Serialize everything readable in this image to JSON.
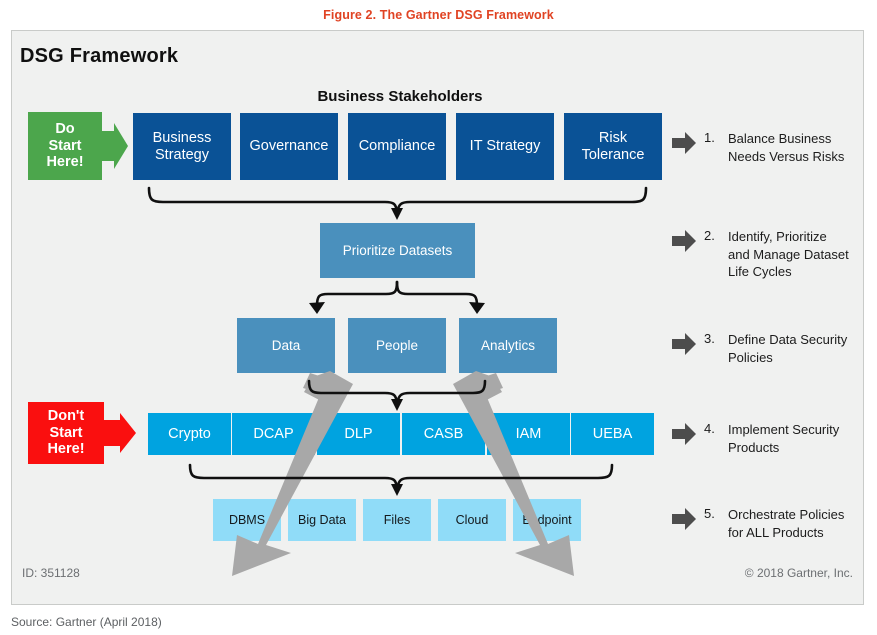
{
  "figure": {
    "caption": "Figure 2. The Gartner DSG Framework",
    "caption_color": "#e04323"
  },
  "panel": {
    "title": "DSG Framework",
    "id_label": "ID: 351128",
    "copyright": "© 2018 Gartner, Inc.",
    "background": "#f0f1f0",
    "border": "#c9cbc9"
  },
  "source_line": "Source: Gartner (April 2018)",
  "banners": {
    "do_start": {
      "line1": "Do",
      "line2": "Start",
      "line3": "Here!",
      "color": "#4ca64c"
    },
    "dont_start": {
      "line1": "Don't",
      "line2": "Start",
      "line3": "Here!",
      "color": "#fa0f0f"
    }
  },
  "stakeholders_heading": "Business Stakeholders",
  "rows": {
    "stakeholders": {
      "color": "#0a5296",
      "items": [
        {
          "line1": "Business",
          "line2": "Strategy"
        },
        {
          "line1": "Governance",
          "line2": ""
        },
        {
          "line1": "Compliance",
          "line2": ""
        },
        {
          "line1": "IT Strategy",
          "line2": ""
        },
        {
          "line1": "Risk",
          "line2": "Tolerance"
        }
      ]
    },
    "prioritize": {
      "color": "#4a90bd",
      "label": "Prioritize Datasets"
    },
    "domains": {
      "color": "#4a90bd",
      "items": [
        "Data",
        "People",
        "Analytics"
      ]
    },
    "products": {
      "color": "#00a3e0",
      "items": [
        "Crypto",
        "DCAP",
        "DLP",
        "CASB",
        "IAM",
        "UEBA"
      ]
    },
    "repositories": {
      "color": "#90dcf8",
      "items": [
        "DBMS",
        "Big Data",
        "Files",
        "Cloud",
        "Endpoint"
      ]
    }
  },
  "steps": [
    {
      "num": "1.",
      "text": "Balance Business\nNeeds Versus Risks"
    },
    {
      "num": "2.",
      "text": "Identify, Prioritize\nand Manage Dataset\nLife Cycles"
    },
    {
      "num": "3.",
      "text": "Define Data Security\nPolicies"
    },
    {
      "num": "4.",
      "text": "Implement Security\nProducts"
    },
    {
      "num": "5.",
      "text": "Orchestrate Policies\nfor ALL Products"
    }
  ]
}
